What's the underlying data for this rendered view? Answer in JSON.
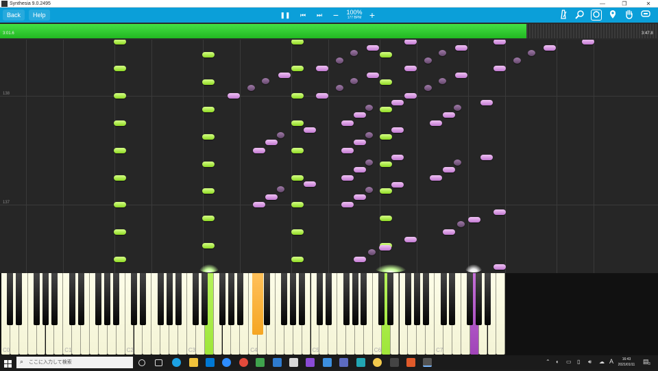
{
  "window": {
    "title": "Synthesia 9.0.2495",
    "minimize": "—",
    "maximize": "❐",
    "close": "✕"
  },
  "toolbar": {
    "back_label": "Back",
    "help_label": "Help",
    "speed_percent": "100%",
    "speed_bpm": "177 BPM",
    "pause_glyph": "❚❚",
    "prev_glyph": "⏮",
    "next_glyph": "⏭",
    "minus_glyph": "−",
    "plus_glyph": "+",
    "right_icons": [
      "metronome-icon",
      "zoom-icon",
      "loop-icon",
      "location-icon",
      "hand-icon",
      "settings-icon"
    ]
  },
  "progress": {
    "elapsed": "3:01.6",
    "total": "3:47.8",
    "fraction": 0.8,
    "fill_color": "#33cc33"
  },
  "measures": {
    "upper": "138",
    "lower": "137"
  },
  "keyboard": {
    "octave_labels": [
      "C0",
      "C1",
      "C2",
      "C3",
      "C4",
      "C5",
      "C6",
      "C7"
    ]
  },
  "colors": {
    "left_hand": "#9fe63a",
    "right_hand": "#d99ae3",
    "active_orange": "#f5a623",
    "toolbar": "#0b9fd9"
  },
  "taskbar": {
    "search_placeholder": "ここに入力して検索",
    "ime": "A",
    "time": "16:43",
    "date": "2021/01/11",
    "notif_count": "3"
  }
}
